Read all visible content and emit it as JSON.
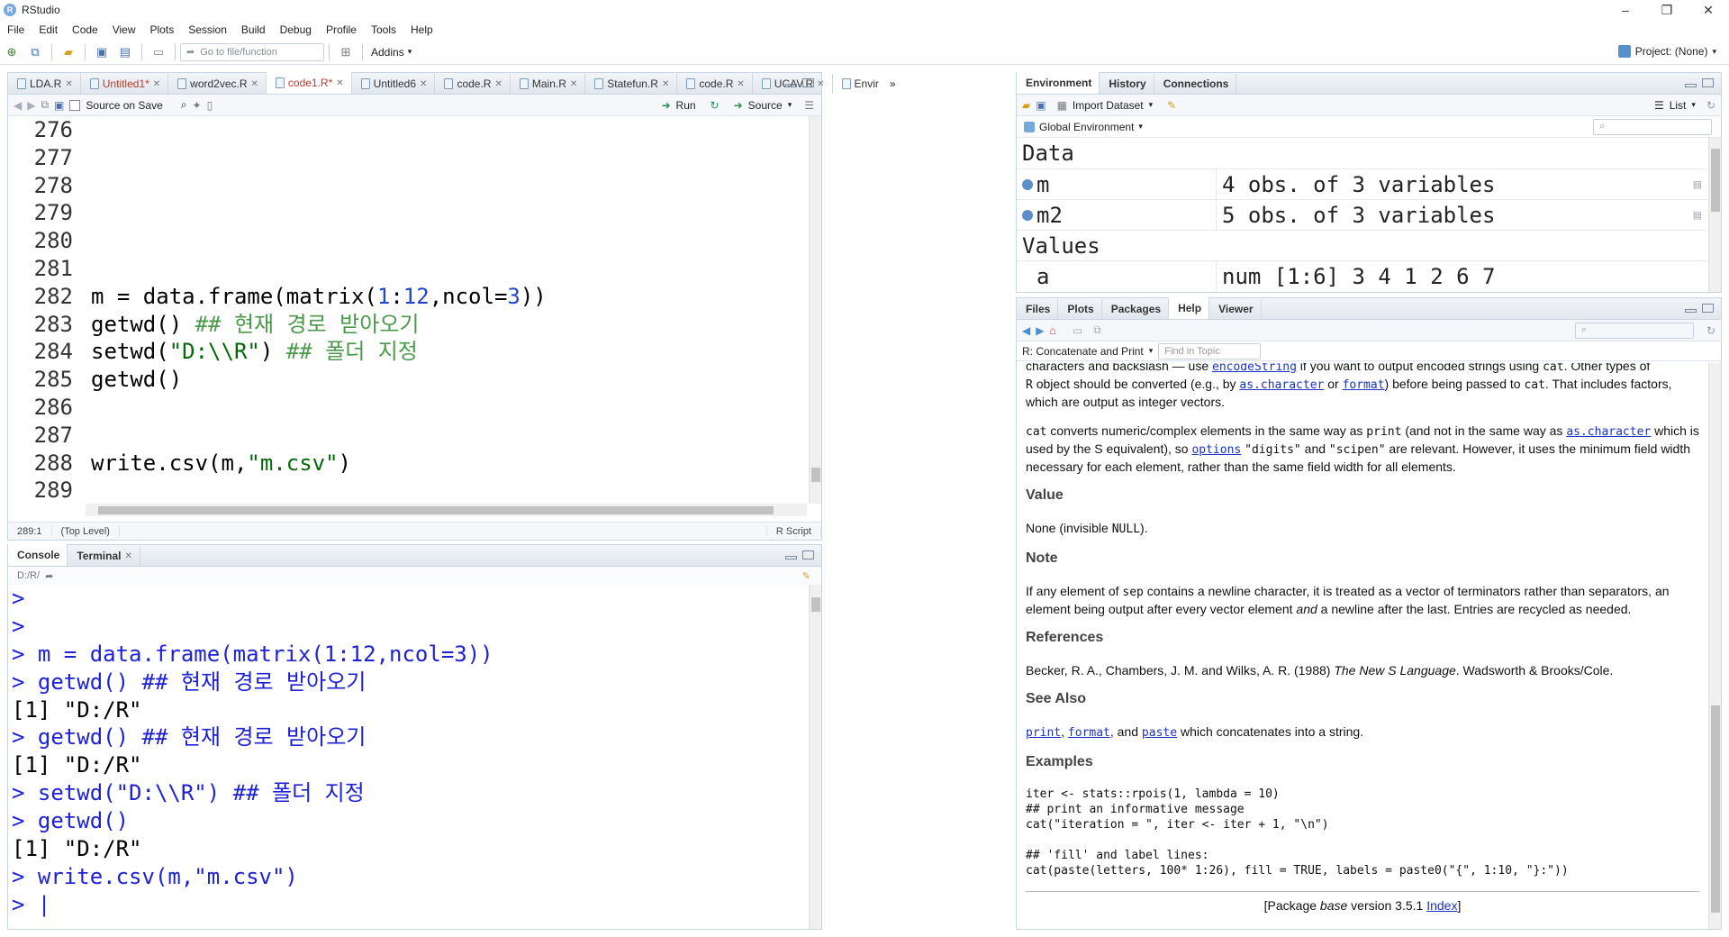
{
  "window": {
    "title": "RStudio",
    "controls": [
      "–",
      "❐",
      "✕"
    ]
  },
  "menu": [
    "File",
    "Edit",
    "Code",
    "View",
    "Plots",
    "Session",
    "Build",
    "Debug",
    "Profile",
    "Tools",
    "Help"
  ],
  "toolbar": {
    "goto_placeholder": "Go to file/function",
    "addins": "Addins",
    "project": "Project: (None)"
  },
  "editor": {
    "tabs": [
      {
        "label": "LDA.R",
        "dirty": false
      },
      {
        "label": "Untitled1*",
        "dirty": true
      },
      {
        "label": "word2vec.R",
        "dirty": false
      },
      {
        "label": "code1.R*",
        "dirty": true,
        "active": true
      },
      {
        "label": "Untitled6",
        "dirty": false
      },
      {
        "label": "code.R",
        "dirty": false
      },
      {
        "label": "Main.R",
        "dirty": false
      },
      {
        "label": "Statefun.R",
        "dirty": false
      },
      {
        "label": "code.R",
        "dirty": false
      },
      {
        "label": "UCAV.R",
        "dirty": false
      },
      {
        "label": "Envir",
        "dirty": false
      }
    ],
    "source_on_save": "Source on Save",
    "run": "Run",
    "source": "Source",
    "line_numbers": [
      "276",
      "277",
      "278",
      "279",
      "280",
      "281",
      "282",
      "283",
      "284",
      "285",
      "286",
      "287",
      "288",
      "289"
    ],
    "lines": {
      "l282_a": "m = data.frame(matrix(",
      "l282_b": "1",
      "l282_c": ":",
      "l282_d": "12",
      "l282_e": ",ncol=",
      "l282_f": "3",
      "l282_g": "))",
      "l283_a": "getwd() ",
      "l283_b": "## 현재 경로 받아오기",
      "l284_a": "setwd(",
      "l284_b": "\"D:\\\\R\"",
      "l284_c": ") ",
      "l284_d": "## 폴더 지정",
      "l285": "getwd()",
      "l288_a": "write.csv(m,",
      "l288_b": "\"m.csv\"",
      "l288_c": ")"
    },
    "status": {
      "position": "289:1",
      "scope": "(Top Level)",
      "type": "R Script"
    }
  },
  "console": {
    "tabs": [
      "Console",
      "Terminal"
    ],
    "path": "D:/R/",
    "lines": [
      {
        "kind": "in",
        "text": ">"
      },
      {
        "kind": "in",
        "text": ">"
      },
      {
        "kind": "in",
        "text": "> m = data.frame(matrix(1:12,ncol=3))"
      },
      {
        "kind": "in",
        "text": "> getwd() ## 현재 경로 받아오기"
      },
      {
        "kind": "out",
        "text": "[1] \"D:/R\""
      },
      {
        "kind": "in",
        "text": "> getwd() ## 현재 경로 받아오기"
      },
      {
        "kind": "out",
        "text": "[1] \"D:/R\""
      },
      {
        "kind": "in",
        "text": "> setwd(\"D:\\\\R\") ## 폴더 지정"
      },
      {
        "kind": "in",
        "text": "> getwd()"
      },
      {
        "kind": "out",
        "text": "[1] \"D:/R\""
      },
      {
        "kind": "in",
        "text": "> write.csv(m,\"m.csv\")"
      },
      {
        "kind": "in",
        "text": "> |"
      }
    ]
  },
  "environment": {
    "tabs": [
      "Environment",
      "History",
      "Connections"
    ],
    "import_dataset": "Import Dataset",
    "list_view": "List",
    "scope": "Global Environment",
    "data_header": "Data",
    "data": [
      {
        "name": "m",
        "value": "4 obs. of 3 variables"
      },
      {
        "name": "m2",
        "value": "5 obs. of 3 variables"
      }
    ],
    "values_header": "Values",
    "values": [
      {
        "name": "a",
        "value": "num [1:6] 3 4 1 2 6 7"
      }
    ]
  },
  "files": {
    "tabs": [
      "Files",
      "Plots",
      "Packages",
      "Help",
      "Viewer"
    ],
    "topic": "R: Concatenate and Print",
    "find_placeholder": "Find in Topic"
  },
  "help": {
    "p0_a": "characters and backslash — use ",
    "p0_link": "encodeString",
    "p0_b": " if you want to output encoded strings using ",
    "p0_code": "cat",
    "p0_c": ". Other types of ",
    "p1_a": "R",
    "p1_b": " object should be converted (e.g., by ",
    "p1_link1": "as.character",
    "p1_c": " or ",
    "p1_link2": "format",
    "p1_d": ") before being passed to ",
    "p1_code": "cat",
    "p1_e": ". That includes factors, which are output as integer vectors.",
    "p2_code1": "cat",
    "p2_a": " converts numeric/complex elements in the same way as ",
    "p2_code2": "print",
    "p2_b": " (and not in the same way as ",
    "p2_link1": "as.character",
    "p2_c": " which is used by the S equivalent), so ",
    "p2_link2": "options",
    "p2_code3": "\"digits\"",
    "p2_d": " and ",
    "p2_code4": "\"scipen\"",
    "p2_e": " are relevant. However, it uses the minimum field width necessary for each element, rather than the same field width for all elements.",
    "value_h": "Value",
    "value_a": "None (invisible ",
    "value_code": "NULL",
    "value_b": ").",
    "note_h": "Note",
    "note_a": "If any element of ",
    "note_code": "sep",
    "note_b": " contains a newline character, it is treated as a vector of terminators rather than separators, an element being output after every vector element ",
    "note_em": "and",
    "note_c": " a newline after the last. Entries are recycled as needed.",
    "refs_h": "References",
    "refs_a": "Becker, R. A., Chambers, J. M. and Wilks, A. R. (1988) ",
    "refs_em": "The New S Language",
    "refs_b": ". Wadsworth & Brooks/Cole.",
    "see_h": "See Also",
    "see_l1": "print",
    "see_a": ", ",
    "see_l2": "format",
    "see_b": ", and ",
    "see_l3": "paste",
    "see_c": " which concatenates into a string.",
    "ex_h": "Examples",
    "ex_code": "iter <- stats::rpois(1, lambda = 10)\n## print an informative message\ncat(\"iteration = \", iter <- iter + 1, \"\\n\")\n\n## 'fill' and label lines:\ncat(paste(letters, 100* 1:26), fill = TRUE, labels = paste0(\"{\", 1:10, \"}:\"))",
    "footer_a": "[Package ",
    "footer_em": "base",
    "footer_b": " version 3.5.1 ",
    "footer_link": "Index",
    "footer_c": "]"
  }
}
